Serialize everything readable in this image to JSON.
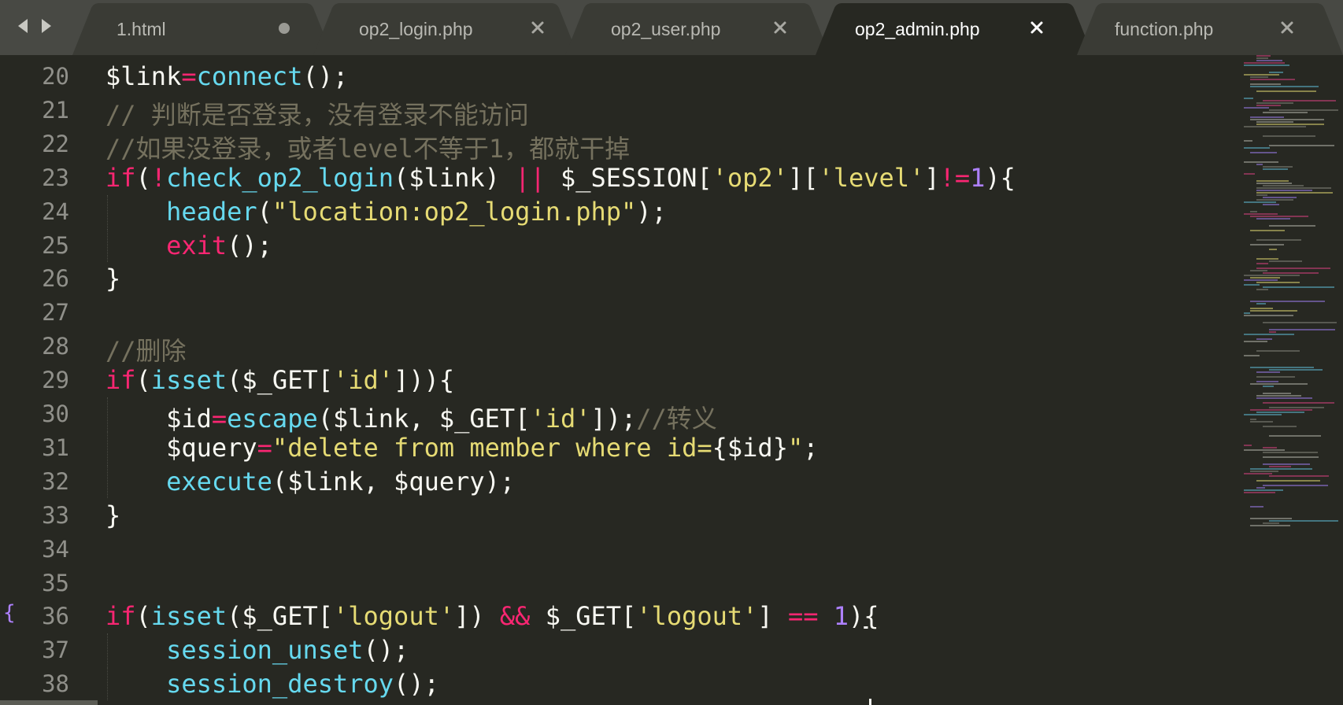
{
  "tabs": [
    {
      "label": "1.html",
      "state": "modified",
      "active": false
    },
    {
      "label": "op2_login.php",
      "state": "close",
      "active": false
    },
    {
      "label": "op2_user.php",
      "state": "close",
      "active": false
    },
    {
      "label": "op2_admin.php",
      "state": "close",
      "active": true
    },
    {
      "label": "function.php",
      "state": "close",
      "active": false
    }
  ],
  "icons": {
    "back": "arrow-left-icon",
    "forward": "arrow-right-icon",
    "modified": "dot-icon",
    "close": "close-x-icon"
  },
  "theme": {
    "background": "#272822",
    "tabbar": "#484944",
    "keyword": "#f92672",
    "function": "#66d9ef",
    "string": "#e6db74",
    "number": "#ae81ff",
    "comment": "#75715e",
    "text": "#f8f8f2"
  },
  "gutter": {
    "marker_line": "36",
    "marker_text": "{"
  },
  "lines": [
    {
      "n": "20",
      "indent": false,
      "tokens": [
        [
          "pl",
          "$link"
        ],
        [
          "kw",
          "="
        ],
        [
          "fn",
          "connect"
        ],
        [
          "pl",
          "();"
        ]
      ]
    },
    {
      "n": "21",
      "indent": false,
      "tokens": [
        [
          "cm",
          "// 判断是否登录，没有登录不能访问"
        ]
      ]
    },
    {
      "n": "22",
      "indent": false,
      "tokens": [
        [
          "cm",
          "//如果没登录，或者level不等于1，都就干掉"
        ]
      ]
    },
    {
      "n": "23",
      "indent": false,
      "tokens": [
        [
          "kw",
          "if"
        ],
        [
          "pl",
          "("
        ],
        [
          "kw",
          "!"
        ],
        [
          "fn",
          "check_op2_login"
        ],
        [
          "pl",
          "($link) "
        ],
        [
          "kw",
          "||"
        ],
        [
          "pl",
          " $_SESSION["
        ],
        [
          "str",
          "'op2'"
        ],
        [
          "pl",
          "]["
        ],
        [
          "str",
          "'level'"
        ],
        [
          "pl",
          "]"
        ],
        [
          "kw",
          "!="
        ],
        [
          "num",
          "1"
        ],
        [
          "pl",
          "){"
        ]
      ]
    },
    {
      "n": "24",
      "indent": true,
      "tokens": [
        [
          "pl",
          "    "
        ],
        [
          "fn",
          "header"
        ],
        [
          "pl",
          "("
        ],
        [
          "str",
          "\"location:op2_login.php\""
        ],
        [
          "pl",
          ");"
        ]
      ]
    },
    {
      "n": "25",
      "indent": true,
      "tokens": [
        [
          "pl",
          "    "
        ],
        [
          "kw",
          "exit"
        ],
        [
          "pl",
          "();"
        ]
      ]
    },
    {
      "n": "26",
      "indent": false,
      "tokens": [
        [
          "pl",
          "}"
        ]
      ]
    },
    {
      "n": "27",
      "indent": false,
      "tokens": []
    },
    {
      "n": "28",
      "indent": false,
      "tokens": [
        [
          "cm",
          "//删除"
        ]
      ]
    },
    {
      "n": "29",
      "indent": false,
      "tokens": [
        [
          "kw",
          "if"
        ],
        [
          "pl",
          "("
        ],
        [
          "fn",
          "isset"
        ],
        [
          "pl",
          "($_GET["
        ],
        [
          "str",
          "'id'"
        ],
        [
          "pl",
          "])){"
        ]
      ]
    },
    {
      "n": "30",
      "indent": true,
      "tokens": [
        [
          "pl",
          "    $id"
        ],
        [
          "kw",
          "="
        ],
        [
          "fn",
          "escape"
        ],
        [
          "pl",
          "($link, $_GET["
        ],
        [
          "str",
          "'id'"
        ],
        [
          "pl",
          "]);"
        ],
        [
          "cm",
          "//转义"
        ]
      ]
    },
    {
      "n": "31",
      "indent": true,
      "tokens": [
        [
          "pl",
          "    $query"
        ],
        [
          "kw",
          "="
        ],
        [
          "str",
          "\"delete from member where id="
        ],
        [
          "pl",
          "{$id}"
        ],
        [
          "str",
          "\""
        ],
        [
          "pl",
          ";"
        ]
      ]
    },
    {
      "n": "32",
      "indent": true,
      "tokens": [
        [
          "pl",
          "    "
        ],
        [
          "fn",
          "execute"
        ],
        [
          "pl",
          "($link, $query);"
        ]
      ]
    },
    {
      "n": "33",
      "indent": false,
      "tokens": [
        [
          "pl",
          "}"
        ]
      ]
    },
    {
      "n": "34",
      "indent": false,
      "tokens": []
    },
    {
      "n": "35",
      "indent": false,
      "tokens": []
    },
    {
      "n": "36",
      "indent": false,
      "tokens": [
        [
          "kw",
          "if"
        ],
        [
          "pl",
          "("
        ],
        [
          "fn",
          "isset"
        ],
        [
          "pl",
          "($_GET["
        ],
        [
          "str",
          "'logout'"
        ],
        [
          "pl",
          "]) "
        ],
        [
          "kw",
          "&&"
        ],
        [
          "pl",
          " $_GET["
        ],
        [
          "str",
          "'logout'"
        ],
        [
          "pl",
          "] "
        ],
        [
          "kw",
          "=="
        ],
        [
          "pl",
          " "
        ],
        [
          "num",
          "1"
        ],
        [
          "pl",
          ")"
        ],
        [
          "ul",
          "{"
        ]
      ]
    },
    {
      "n": "37",
      "indent": true,
      "tokens": [
        [
          "pl",
          "    "
        ],
        [
          "fn",
          "session_unset"
        ],
        [
          "pl",
          "();"
        ]
      ]
    },
    {
      "n": "38",
      "indent": true,
      "tokens": [
        [
          "pl",
          "    "
        ],
        [
          "fn",
          "session_destroy"
        ],
        [
          "pl",
          "();"
        ]
      ]
    }
  ]
}
